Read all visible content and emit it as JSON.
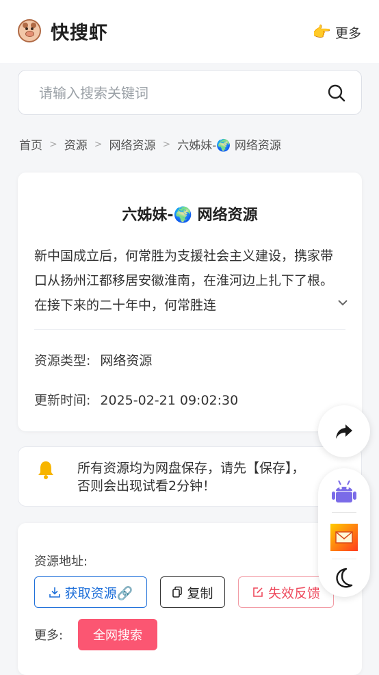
{
  "header": {
    "brand": "快搜虾",
    "more_label": "更多",
    "more_icon": "pointing-hand-icon"
  },
  "search": {
    "placeholder": "请输入搜索关键词",
    "value": ""
  },
  "breadcrumb": {
    "items": [
      "首页",
      "资源",
      "网络资源",
      "六姊妹-🌍 网络资源"
    ]
  },
  "resource": {
    "title": "六姊妹-🌍 网络资源",
    "description": "新中国成立后，何常胜为支援社会主义建设，携家带口从扬州江都移居安徽淮南，在淮河边上扎下了根。在接下来的二十年中，何常胜连",
    "type_label": "资源类型:",
    "type_value": "网络资源",
    "updated_label": "更新时间:",
    "updated_value": "2025-02-21 09:02:30"
  },
  "notice": {
    "text": "所有资源均为网盘保存，请先【保存】，否则会出现试看2分钟！"
  },
  "links": {
    "address_label": "资源地址:",
    "get_label": "获取资源🔗",
    "copy_label": "复制",
    "report_label": "失效反馈",
    "more_label": "更多:",
    "search_all_label": "全网搜索"
  },
  "colors": {
    "primary_blue": "#1e6fd9",
    "danger_red": "#ee4a5d",
    "search_all_bg": "#fb5672",
    "page_bg": "#f5f6f8"
  }
}
